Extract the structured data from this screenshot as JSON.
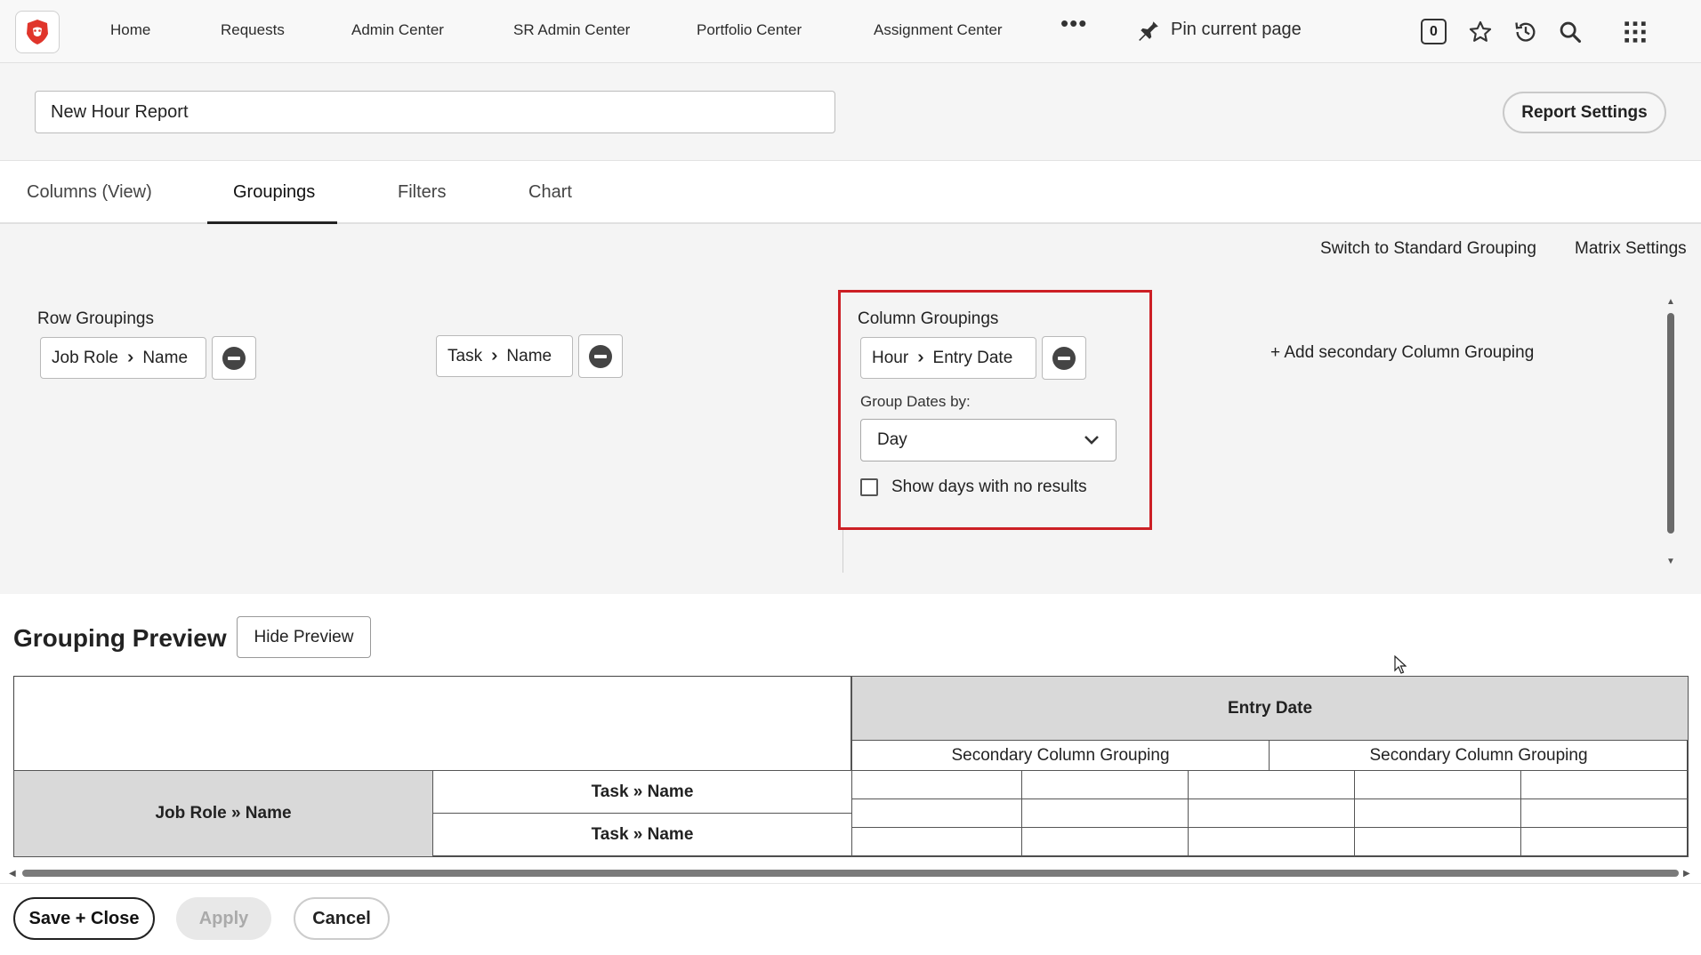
{
  "nav": {
    "items": [
      "Home",
      "Requests",
      "Admin Center",
      "SR Admin Center",
      "Portfolio Center",
      "Assignment Center"
    ],
    "more": "•••",
    "pin_label": "Pin current page",
    "counter": "0",
    "icons": [
      "pin-icon",
      "star-icon",
      "history-icon",
      "search-icon",
      "apps-grid-icon"
    ]
  },
  "header": {
    "report_name": "New Hour Report",
    "report_settings": "Report Settings"
  },
  "tabs": [
    "Columns (View)",
    "Groupings",
    "Filters",
    "Chart"
  ],
  "active_tab": "Groupings",
  "groupings": {
    "switch_link": "Switch to Standard Grouping",
    "matrix_link": "Matrix Settings",
    "row_label": "Row Groupings",
    "row_chip_1": {
      "object": "Job Role",
      "field": "Name"
    },
    "row_chip_2": {
      "object": "Task",
      "field": "Name"
    },
    "column_label": "Column Groupings",
    "column_chip": {
      "object": "Hour",
      "field": "Entry Date"
    },
    "group_dates_label": "Group Dates by:",
    "group_dates_value": "Day",
    "show_days_label": "Show days with no results",
    "add_secondary": "+ Add secondary Column Grouping"
  },
  "preview": {
    "title": "Grouping Preview",
    "hide_button": "Hide Preview",
    "column_header": "Entry Date",
    "secondary_1": "Secondary Column Grouping",
    "secondary_2": "Secondary Column Grouping",
    "row_header": "Job Role » Name",
    "sub_row_1": "Task » Name",
    "sub_row_2": "Task » Name"
  },
  "footer": {
    "save_close": "Save + Close",
    "apply": "Apply",
    "cancel": "Cancel"
  },
  "colors": {
    "highlight": "#cc1f25",
    "brand": "#e0352b"
  }
}
